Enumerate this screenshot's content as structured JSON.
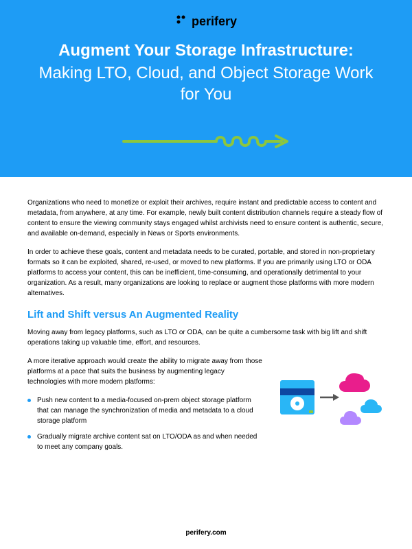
{
  "brand": {
    "name": "perifery"
  },
  "hero": {
    "title_line1": "Augment Your Storage Infrastructure:",
    "title_line2": "Making LTO, Cloud, and Object Storage Work for You"
  },
  "body": {
    "para1": "Organizations who need to monetize or exploit their archives, require instant and predictable access to content and metadata, from anywhere, at any time. For example, newly built content distribution channels require a steady flow of content to ensure the viewing community stays engaged whilst archivists need to ensure content is authentic, secure, and available on-demand, especially in News or Sports environments.",
    "para2": "In order to achieve these goals, content and metadata needs to be curated, portable, and stored in non-proprietary formats so it can be exploited, shared, re-used, or moved to new platforms. If you are primarily using LTO or ODA platforms to access your content, this can be inefficient, time-consuming, and operationally detrimental to your organization. As a result, many organizations are looking to replace or augment those platforms with more modern alternatives.",
    "heading1": "Lift and Shift versus An Augmented Reality",
    "para3": "Moving away from legacy platforms, such as LTO or ODA, can be quite a cumbersome task with big lift and shift operations taking up valuable time, effort, and resources.",
    "para4": "A more iterative approach would create the ability to migrate away from those platforms at a pace that suits the business by augmenting legacy technologies with more modern platforms:",
    "bullets": [
      "Push new content to a media-focused on-prem object storage platform that can manage the synchronization of media and metadata to a cloud storage platform",
      "Gradually migrate archive content sat on LTO/ODA as and when needed to meet any company goals."
    ]
  },
  "footer": {
    "url": "perifery.com"
  },
  "colors": {
    "accent_blue": "#1e9cf5",
    "squiggle_green": "#8cc63f",
    "cloud_magenta": "#e91e8c",
    "cloud_blue": "#29b6f6",
    "cloud_purple": "#b388ff",
    "disk_blue": "#29b6f6",
    "disk_band": "#0d47a1"
  }
}
